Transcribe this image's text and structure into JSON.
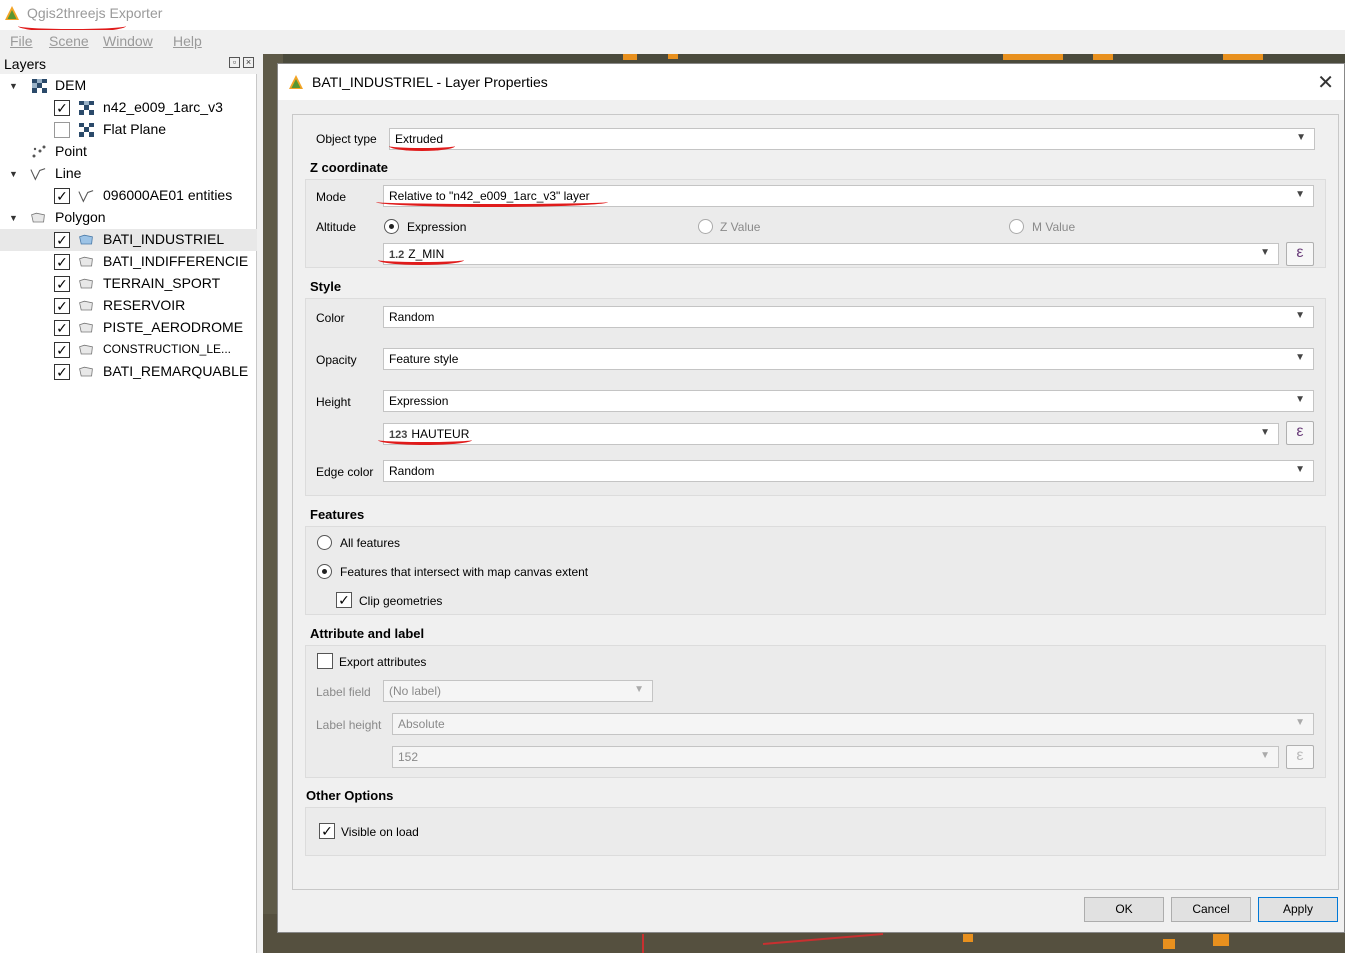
{
  "app": {
    "title": "Qgis2threejs Exporter",
    "menu": [
      "File",
      "Scene",
      "Window",
      "Help"
    ]
  },
  "layers": {
    "title": "Layers",
    "items": [
      {
        "label": "DEM",
        "checked": null
      },
      {
        "label": "n42_e009_1arc_v3",
        "checked": true
      },
      {
        "label": "Flat Plane",
        "checked": false
      },
      {
        "label": "Point",
        "checked": null
      },
      {
        "label": "Line",
        "checked": null
      },
      {
        "label": "096000AE01 entities",
        "checked": true
      },
      {
        "label": "Polygon",
        "checked": null
      },
      {
        "label": "BATI_INDUSTRIEL",
        "checked": true
      },
      {
        "label": "BATI_INDIFFERENCIE",
        "checked": true
      },
      {
        "label": "TERRAIN_SPORT",
        "checked": true
      },
      {
        "label": "RESERVOIR",
        "checked": true
      },
      {
        "label": "PISTE_AERODROME",
        "checked": true
      },
      {
        "label": "CONSTRUCTION_LE...",
        "checked": true
      },
      {
        "label": "BATI_REMARQUABLE",
        "checked": true
      }
    ]
  },
  "dialog": {
    "title": "BATI_INDUSTRIEL - Layer Properties",
    "object_type": {
      "label": "Object type",
      "value": "Extruded"
    },
    "z_coordinate": {
      "title": "Z coordinate",
      "mode_label": "Mode",
      "mode_value": "Relative to \"n42_e009_1arc_v3\" layer",
      "altitude_label": "Altitude",
      "radio_expression": "Expression",
      "radio_z": "Z Value",
      "radio_m": "M Value",
      "altitude_expr_tag": "1.2",
      "altitude_expr": "Z_MIN"
    },
    "style": {
      "title": "Style",
      "color_label": "Color",
      "color_value": "Random",
      "opacity_label": "Opacity",
      "opacity_value": "Feature style",
      "height_label": "Height",
      "height_value": "Expression",
      "height_expr_tag": "123",
      "height_expr": "HAUTEUR",
      "edge_label": "Edge color",
      "edge_value": "Random"
    },
    "features": {
      "title": "Features",
      "all": "All features",
      "intersect": "Features that intersect with map canvas extent",
      "clip": "Clip geometries"
    },
    "attribute": {
      "title": "Attribute and label",
      "export": "Export attributes",
      "label_field_label": "Label field",
      "label_field_value": "(No label)",
      "label_height_label": "Label height",
      "label_height_value": "Absolute",
      "label_height_num": "152"
    },
    "other": {
      "title": "Other Options",
      "visible": "Visible on load"
    },
    "buttons": {
      "ok": "OK",
      "cancel": "Cancel",
      "apply": "Apply"
    },
    "epsilon": "ε",
    "check": "✓"
  },
  "colors": {
    "annotation_red": "#e01b1b",
    "qgis_green": "#589632"
  }
}
